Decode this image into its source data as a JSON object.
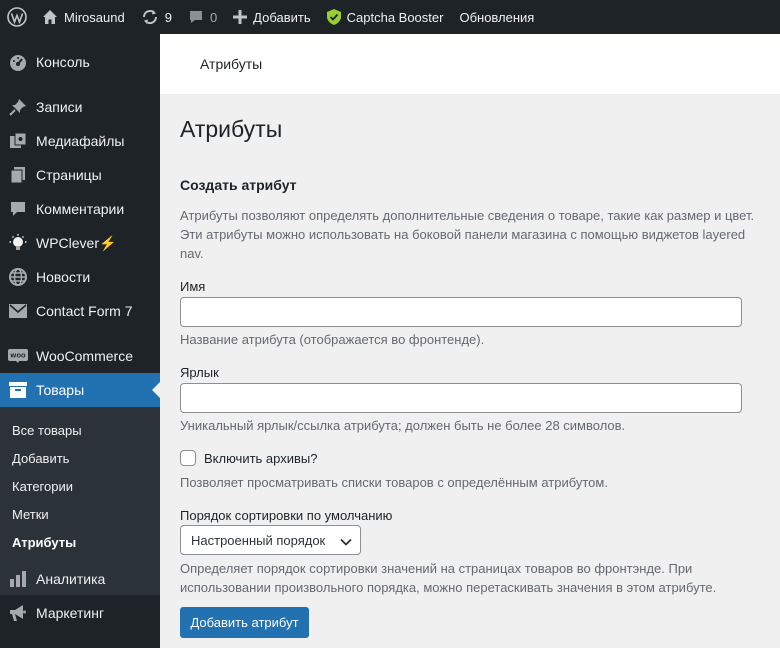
{
  "adminbar": {
    "site_name": "Mirosaund",
    "updates_count": "9",
    "comments_count": "0",
    "add_new_label": "Добавить",
    "captcha_label": "Captcha Booster",
    "updates_label": "Обновления"
  },
  "sidebar": {
    "items": [
      {
        "label": "Консоль",
        "icon": "dashboard-icon"
      },
      {
        "label": "Записи",
        "icon": "pin-icon"
      },
      {
        "label": "Медиафайлы",
        "icon": "media-icon"
      },
      {
        "label": "Страницы",
        "icon": "pages-icon"
      },
      {
        "label": "Комментарии",
        "icon": "comment-icon"
      },
      {
        "label": "WPClever⚡",
        "icon": "lightbulb-icon"
      },
      {
        "label": "Новости",
        "icon": "globe-icon"
      },
      {
        "label": "Contact Form 7",
        "icon": "envelope-icon"
      },
      {
        "label": "WooCommerce",
        "icon": "woo-icon"
      },
      {
        "label": "Товары",
        "icon": "archive-icon"
      },
      {
        "label": "Аналитика",
        "icon": "bar-chart-icon"
      },
      {
        "label": "Маркетинг",
        "icon": "megaphone-icon"
      }
    ],
    "submenu": [
      "Все товары",
      "Добавить",
      "Категории",
      "Метки",
      "Атрибуты"
    ]
  },
  "header": {
    "title": "Атрибуты"
  },
  "page": {
    "title": "Атрибуты",
    "form_heading": "Создать атрибут",
    "intro_line1": "Атрибуты позволяют определять дополнительные сведения о товаре, такие как размер и цвет.",
    "intro_line2": "Эти атрибуты можно использовать на боковой панели магазина с помощью виджетов layered",
    "intro_line3": "nav.",
    "name_label": "Имя",
    "name_value": "",
    "name_hint": "Название атрибута (отображается во фронтенде).",
    "slug_label": "Ярлык",
    "slug_value": "",
    "slug_hint": "Уникальный ярлык/ссылка атрибута; должен быть не более 28 символов.",
    "archives_label": "Включить архивы?",
    "archives_checked": false,
    "archives_hint": "Позволяет просматривать списки товаров с определённым атрибутом.",
    "sort_label": "Порядок сортировки по умолчанию",
    "sort_selected": "Настроенный порядок",
    "sort_hint_line1": "Определяет порядок сортировки значений на страницах товаров во фронтэнде. При",
    "sort_hint_line2": "использовании произвольного порядка, можно перетаскивать значения в этом атрибуте.",
    "submit_label": "Добавить атрибут"
  },
  "colors": {
    "adminbar_bg": "#1d2327",
    "accent": "#2271b1",
    "content_bg": "#f0f0f1",
    "captcha_icon": "#9acd32"
  }
}
